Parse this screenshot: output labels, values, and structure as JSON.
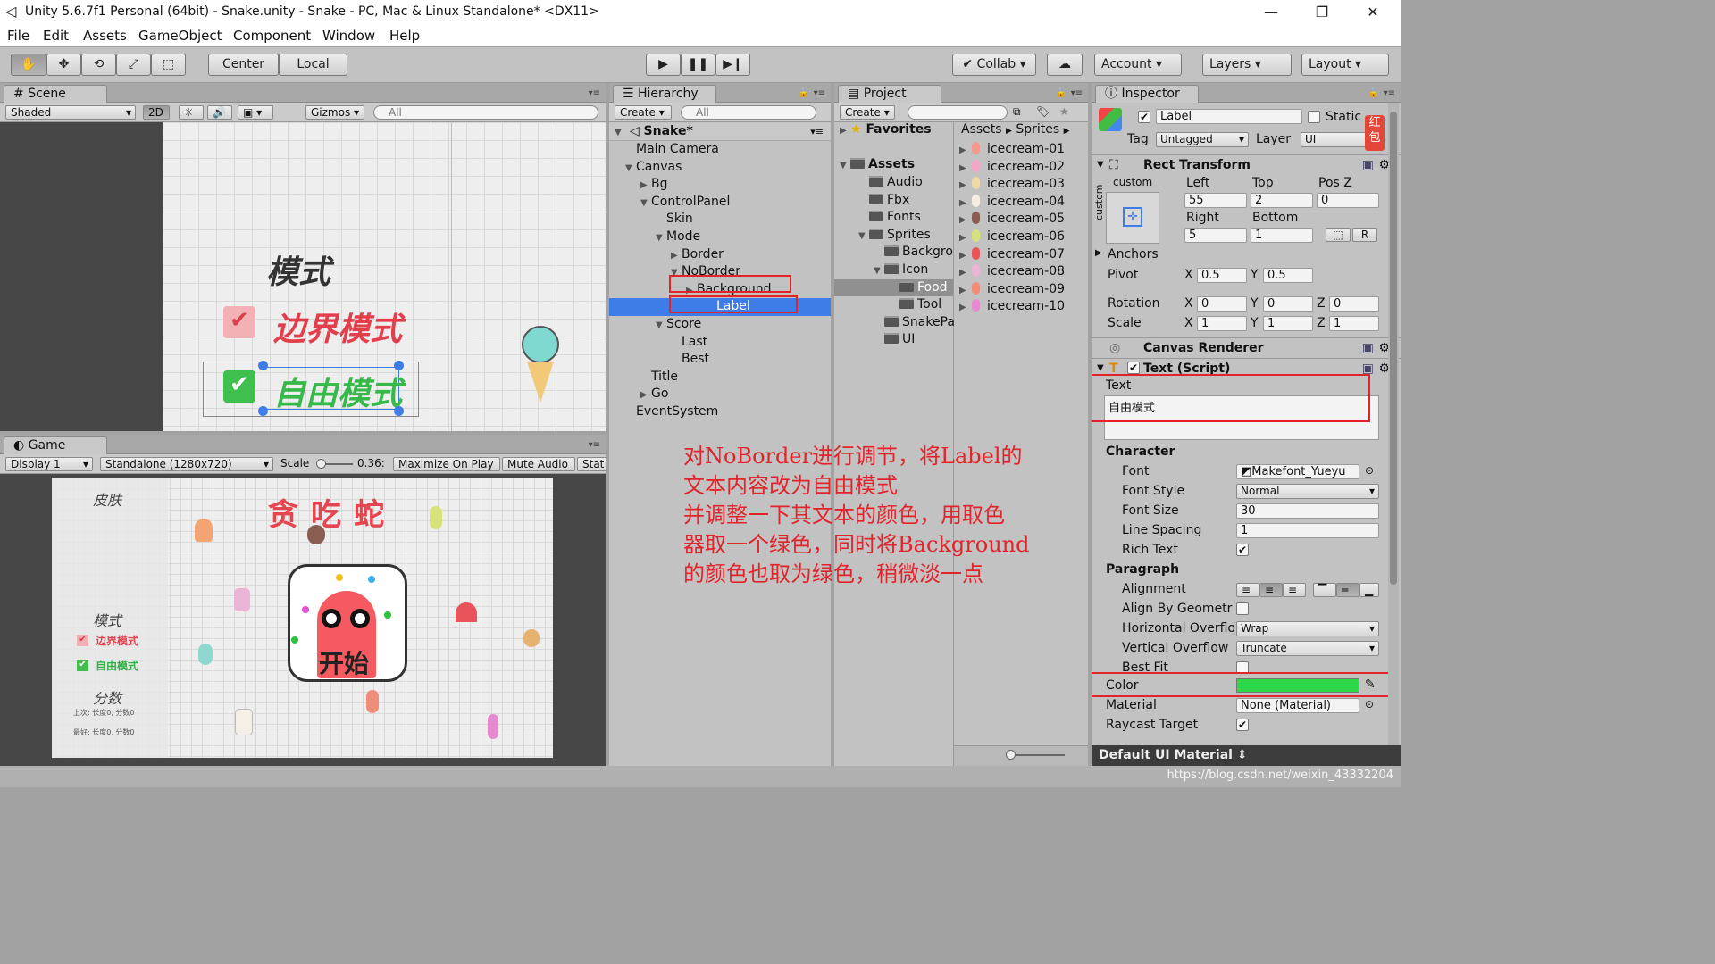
{
  "window": {
    "title": "Unity 5.6.7f1 Personal (64bit) - Snake.unity - Snake - PC, Mac & Linux Standalone* <DX11>"
  },
  "menu": [
    "File",
    "Edit",
    "Assets",
    "GameObject",
    "Component",
    "Window",
    "Help"
  ],
  "toolbar": {
    "center": "Center",
    "local": "Local",
    "collab": "Collab",
    "account": "Account",
    "layers": "Layers",
    "layout": "Layout"
  },
  "scene": {
    "tab": "Scene",
    "shading": "Shaded",
    "mode2d": "2D",
    "gizmos": "Gizmos",
    "search": "All",
    "mode_title": "模式",
    "border_mode": "边界模式",
    "free_mode": "自由模式"
  },
  "game": {
    "tab": "Game",
    "display": "Display 1",
    "resolution": "Standalone (1280x720)",
    "scale_label": "Scale",
    "scale_value": "0.36:",
    "maximize": "Maximize On Play",
    "mute": "Mute Audio",
    "stats": "Stat",
    "skin": "皮肤",
    "title": "贪吃蛇",
    "start": "开始",
    "mode": "模式",
    "border_mode": "边界模式",
    "free_mode": "自由模式",
    "score": "分数",
    "last_row": "上次: 长度0, 分数0",
    "best_row": "最好: 长度0, 分数0"
  },
  "hierarchy": {
    "tab": "Hierarchy",
    "create": "Create",
    "search": "All",
    "scene": "Snake*",
    "items": [
      {
        "label": "Main Camera",
        "depth": 1,
        "arrow": ""
      },
      {
        "label": "Canvas",
        "depth": 1,
        "arrow": "open"
      },
      {
        "label": "Bg",
        "depth": 2,
        "arrow": "closed"
      },
      {
        "label": "ControlPanel",
        "depth": 2,
        "arrow": "open"
      },
      {
        "label": "Skin",
        "depth": 3,
        "arrow": ""
      },
      {
        "label": "Mode",
        "depth": 3,
        "arrow": "open"
      },
      {
        "label": "Border",
        "depth": 4,
        "arrow": "closed"
      },
      {
        "label": "NoBorder",
        "depth": 4,
        "arrow": "open"
      },
      {
        "label": "Background",
        "depth": 5,
        "arrow": "closed"
      },
      {
        "label": "Label",
        "depth": 5,
        "arrow": "",
        "selected": true
      },
      {
        "label": "Score",
        "depth": 3,
        "arrow": "open"
      },
      {
        "label": "Last",
        "depth": 4,
        "arrow": ""
      },
      {
        "label": "Best",
        "depth": 4,
        "arrow": ""
      },
      {
        "label": "Title",
        "depth": 2,
        "arrow": ""
      },
      {
        "label": "Go",
        "depth": 2,
        "arrow": "closed"
      },
      {
        "label": "EventSystem",
        "depth": 1,
        "arrow": ""
      }
    ]
  },
  "project": {
    "tab": "Project",
    "create": "Create",
    "favorites": "Favorites",
    "assets": "Assets",
    "breadcrumb": [
      "Assets",
      "Sprites"
    ],
    "tree": [
      {
        "label": "Audio",
        "depth": 1,
        "arrow": ""
      },
      {
        "label": "Fbx",
        "depth": 1,
        "arrow": ""
      },
      {
        "label": "Fonts",
        "depth": 1,
        "arrow": ""
      },
      {
        "label": "Sprites",
        "depth": 1,
        "arrow": "open"
      },
      {
        "label": "Backgro",
        "depth": 2,
        "arrow": ""
      },
      {
        "label": "Icon",
        "depth": 2,
        "arrow": "open"
      },
      {
        "label": "Food",
        "depth": 3,
        "arrow": "",
        "highlight": true
      },
      {
        "label": "Tool",
        "depth": 3,
        "arrow": ""
      },
      {
        "label": "SnakePa",
        "depth": 2,
        "arrow": ""
      },
      {
        "label": "UI",
        "depth": 2,
        "arrow": ""
      }
    ],
    "files": [
      "icecream-01",
      "icecream-02",
      "icecream-03",
      "icecream-04",
      "icecream-05",
      "icecream-06",
      "icecream-07",
      "icecream-08",
      "icecream-09",
      "icecream-10"
    ]
  },
  "inspector": {
    "tab": "Inspector",
    "name": "Label",
    "static": "Static",
    "tag_label": "Tag",
    "tag": "Untagged",
    "layer_label": "Layer",
    "layer": "UI",
    "rect_transform": "Rect Transform",
    "anchor_preset": "custom",
    "anchor_preset_side": "custom",
    "left_label": "Left",
    "top_label": "Top",
    "posz_label": "Pos Z",
    "left": "55",
    "top": "2",
    "posz": "0",
    "right_label": "Right",
    "bottom_label": "Bottom",
    "right": "5",
    "bottom": "1",
    "r_btn": "R",
    "anchors": "Anchors",
    "pivot": "Pivot",
    "pivot_x": "0.5",
    "pivot_y": "0.5",
    "rotation": "Rotation",
    "rot_x": "0",
    "rot_y": "0",
    "rot_z": "0",
    "scale": "Scale",
    "scale_x": "1",
    "scale_y": "1",
    "scale_z": "1",
    "canvas_renderer": "Canvas Renderer",
    "text_script": "Text (Script)",
    "text_label": "Text",
    "text_value": "自由模式",
    "character": "Character",
    "font_label": "Font",
    "font": "Makefont_Yueyu",
    "font_style_label": "Font Style",
    "font_style": "Normal",
    "font_size_label": "Font Size",
    "font_size": "30",
    "line_spacing_label": "Line Spacing",
    "line_spacing": "1",
    "rich_text_label": "Rich Text",
    "paragraph": "Paragraph",
    "alignment_label": "Alignment",
    "align_geom_label": "Align By Geometr",
    "h_overflow_label": "Horizontal Overflo",
    "h_overflow": "Wrap",
    "v_overflow_label": "Vertical Overflow",
    "v_overflow": "Truncate",
    "best_fit_label": "Best Fit",
    "color_label": "Color",
    "color_value": "#2ed64a",
    "material_label": "Material",
    "material": "None (Material)",
    "raycast_label": "Raycast Target",
    "default_material": "Default UI Material",
    "side_badge": "红包"
  },
  "annotation": [
    "对NoBorder进行调节，将Label的",
    "文本内容改为自由模式",
    "并调整一下其文本的颜色，用取色",
    "器取一个绿色，同时将Background",
    "的颜色也取为绿色，稍微淡一点"
  ],
  "watermark": "https://blog.csdn.net/weixin_43332204"
}
